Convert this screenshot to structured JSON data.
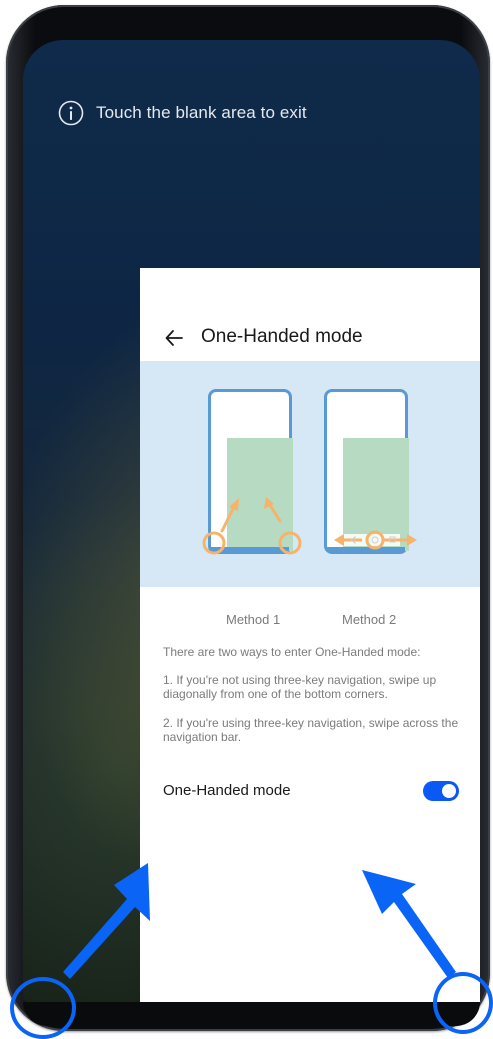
{
  "hint": {
    "text": "Touch the blank area to exit",
    "icon": "info-icon"
  },
  "panel": {
    "title": "One-Handed mode",
    "methods": [
      "Method 1",
      "Method 2"
    ],
    "description": [
      "There are two ways to enter One-Handed mode:",
      "1. If you're not using three-key navigation, swipe up diagonally from one of the bottom corners.",
      "2. If you're using three-key navigation, swipe across the navigation bar."
    ],
    "toggle": {
      "label": "One-Handed mode",
      "state": "on"
    }
  },
  "colors": {
    "accent": "#0a59f7",
    "illustration_bg": "#d6e8f5",
    "illustration_outline": "#5a9ad4",
    "illustration_fill": "#b7dac3",
    "gesture_orange": "#f6b36a",
    "annotation_blue": "#0a64f6"
  }
}
